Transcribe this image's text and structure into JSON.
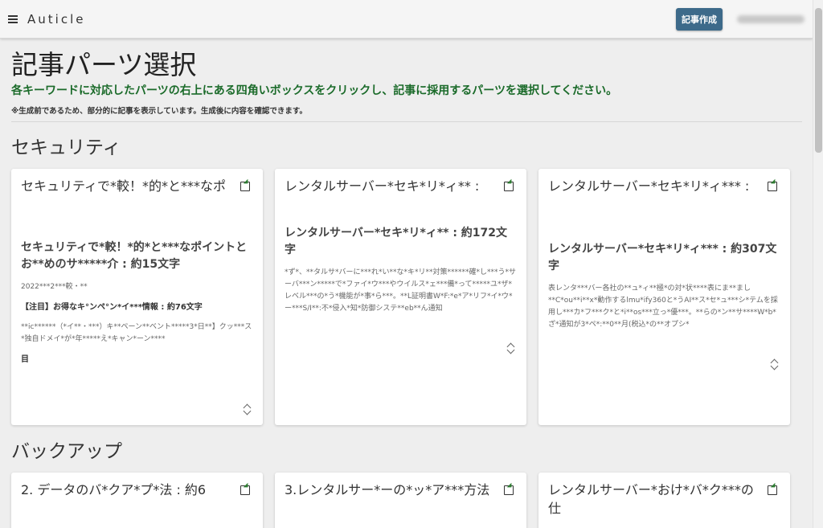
{
  "header": {
    "brand": "Auticle",
    "create_button": "記事作成",
    "user_name": "XXXXXXXX XXTS"
  },
  "page": {
    "title": "記事パーツ選択",
    "instruction": "各キーワードに対応したパーツの右上にある四角いボックスをクリックし、記事に採用するパーツを選択してください。",
    "note": "※生成前であるため、部分的に記事を表示しています。生成後に内容を確認できます。"
  },
  "sections": [
    {
      "title": "セキュリティ",
      "cards": [
        {
          "heading": "セキュリティで*較！*的*と***なポ",
          "subtitle": "セキュリティで*較！*的*と***なポイントとお**めのサ*****介 : 約15文字",
          "text": "2022***2***較・**",
          "mini_title": "【注目】お得なキ°ンペ°ン*イ***情報 : 約76文字",
          "text2": "**ic******（*イ**・***）キ**ペーン**ベント*****3*日**】クッ***ス*独自ドメイ*が*年*****え*キャン*ーン****",
          "mini_title2": "目"
        },
        {
          "heading": "レンタルサーバー*セキ*リ*ィ** :",
          "subtitle": "レンタルサーバー*セキ*リ*ィ** : 約172文字",
          "text": "*ず*、**タルサ*バーに***れ*い**な*キ*リ**対策******確*し***う*サーバ***ン*****で*ファイ*ウ***やウイルス*ェ***備*って*****ユ*ザ*レベル***の*う*機能が*事*ら***。**L証明書W*F:*e*ア*リフ*イ*ウ*ー***S/I**:不*侵入*知*防御システ**eb**ん通知"
        },
        {
          "heading": "レンタルサーバー*セキ*リ*ィ*** :",
          "subtitle": "レンタルサーバー*セキ*リ*ィ*** : 約307文字",
          "text": "表レンタ***バー各社の**ュ*ィ**極*の対*状****表にま**まし**C*ou**i**x*動作するlmu*ify360と*うAI**ス*セ*ュ***シ*テムを採用し***カ*フ***ク*と*i**os***立っ*優***。**らの*ン**サ****W*b*ざ*通知が3*ペ*:**0**月(税込*の**オプシ*"
        }
      ]
    },
    {
      "title": "バックアップ",
      "cards": [
        {
          "heading": "2. データのバ*クア*プ*法 : 約6"
        },
        {
          "heading": "3.レンタルサー*ーの*ッ*ア***方法"
        },
        {
          "heading": "レンタルサーバー*おけ*バ*ク***の仕"
        }
      ]
    }
  ]
}
